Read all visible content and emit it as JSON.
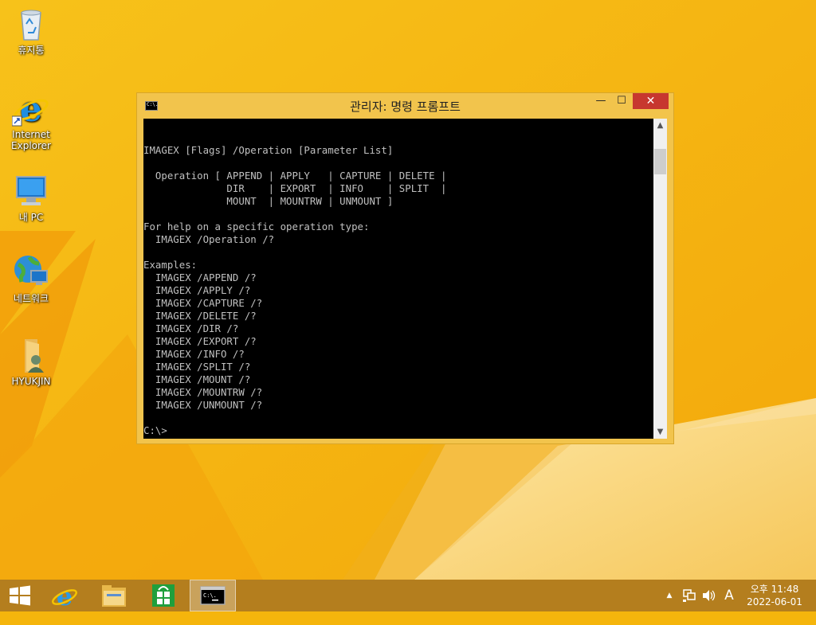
{
  "desktop": {
    "icons": [
      {
        "label": "휴지통",
        "icon": "recycle-bin-icon"
      },
      {
        "label": "Internet\nExplorer",
        "icon": "internet-explorer-icon"
      },
      {
        "label": "내 PC",
        "icon": "computer-icon"
      },
      {
        "label": "네트워크",
        "icon": "network-icon"
      },
      {
        "label": "HYUKJIN",
        "icon": "user-folder-icon"
      }
    ]
  },
  "window": {
    "title": "관리자: 명령 프롬프트",
    "app_icon_text": "C:\\.",
    "minimize_label": "—",
    "maximize_label": "☐",
    "close_label": "✕",
    "console_lines": [
      "",
      "",
      "IMAGEX [Flags] /Operation [Parameter List]",
      "",
      "  Operation [ APPEND | APPLY   | CAPTURE | DELETE |",
      "              DIR    | EXPORT  | INFO    | SPLIT  |",
      "              MOUNT  | MOUNTRW | UNMOUNT ]",
      "",
      "For help on a specific operation type:",
      "  IMAGEX /Operation /?",
      "",
      "Examples:",
      "  IMAGEX /APPEND /?",
      "  IMAGEX /APPLY /?",
      "  IMAGEX /CAPTURE /?",
      "  IMAGEX /DELETE /?",
      "  IMAGEX /DIR /?",
      "  IMAGEX /EXPORT /?",
      "  IMAGEX /INFO /?",
      "  IMAGEX /SPLIT /?",
      "  IMAGEX /MOUNT /?",
      "  IMAGEX /MOUNTRW /?",
      "  IMAGEX /UNMOUNT /?",
      "",
      "C:\\>"
    ]
  },
  "taskbar": {
    "items": [
      "start-icon",
      "internet-explorer-icon",
      "file-explorer-icon",
      "store-icon",
      "command-prompt-icon"
    ],
    "tray": {
      "chevron": "▲",
      "ime_label": "A"
    },
    "clock_time": "오후 11:48",
    "clock_date": "2022-06-01"
  },
  "colors": {
    "desktop_bg": "#f5b50c",
    "window_frame": "#f2c44c",
    "close_button": "#c7372f",
    "console_bg": "#000000",
    "console_text": "#c0c0c0"
  }
}
